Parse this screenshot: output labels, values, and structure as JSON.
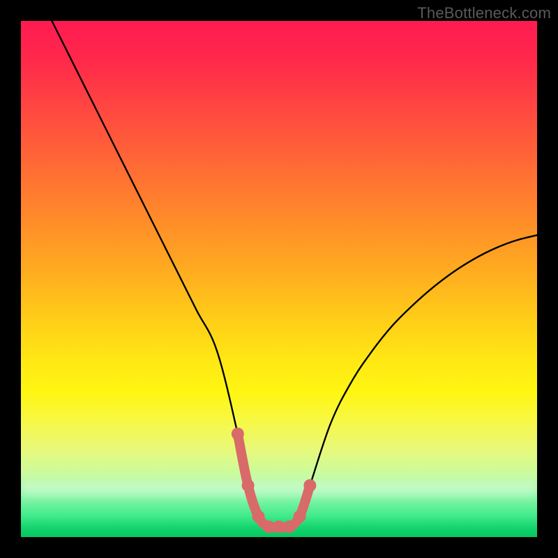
{
  "watermark": "TheBottleneck.com",
  "chart_data": {
    "type": "line",
    "title": "",
    "xlabel": "",
    "ylabel": "",
    "xlim": [
      0,
      100
    ],
    "ylim": [
      0,
      100
    ],
    "series": [
      {
        "name": "bottleneck-curve",
        "x": [
          6,
          10,
          14,
          18,
          22,
          26,
          30,
          34,
          38,
          42,
          44,
          46,
          48,
          50,
          52,
          54,
          56,
          60,
          64,
          68,
          72,
          76,
          80,
          84,
          88,
          92,
          96,
          100
        ],
        "y": [
          100,
          92,
          84,
          76,
          68,
          60,
          52,
          44,
          36,
          20,
          10,
          4,
          2,
          2,
          2,
          4,
          10,
          22,
          30,
          36,
          41,
          45,
          48.5,
          51.5,
          54,
          56,
          57.5,
          58.5
        ]
      },
      {
        "name": "highlight-segment",
        "x": [
          42,
          44,
          46,
          48,
          50,
          52,
          54,
          56
        ],
        "y": [
          20,
          10,
          4,
          2,
          2,
          2,
          4,
          10
        ]
      }
    ],
    "highlight_color": "#d86a6a",
    "curve_color": "#000000"
  }
}
